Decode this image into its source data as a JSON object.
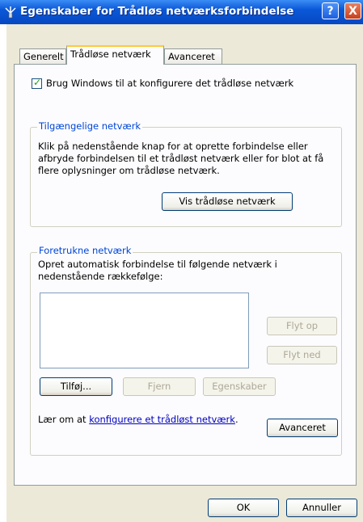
{
  "window": {
    "title": "Egenskaber for Trådløs netværksforbindelse",
    "help_label": "?",
    "close_label": "X"
  },
  "tabs": [
    {
      "label": "Generelt",
      "active": false
    },
    {
      "label": "Trådløse netværk",
      "active": true
    },
    {
      "label": "Avanceret",
      "active": false
    }
  ],
  "checkbox": {
    "label": "Brug Windows til at konfigurere det trådløse netværk",
    "checked": true
  },
  "available": {
    "title": "Tilgængelige netværk",
    "desc": [
      "Klik på nedenstående knap for at oprette forbindelse eller",
      "afbryde forbindelsen til et trådløst netværk eller for blot at få",
      "flere oplysninger om trådløse netværk."
    ],
    "button": "Vis trådløse netværk"
  },
  "preferred": {
    "title": "Foretrukne netværk",
    "desc": [
      "Opret automatisk forbindelse til følgende netværk i",
      "nedenstående rækkefølge:"
    ],
    "move_up": "Flyt op",
    "move_down": "Flyt ned",
    "add": "Tilføj...",
    "remove": "Fjern",
    "properties": "Egenskaber"
  },
  "learn": {
    "prefix": "Lær om at ",
    "link": "konfigurere et trådløst netværk",
    "suffix": "."
  },
  "advanced_button": "Avanceret",
  "footer": {
    "ok": "OK",
    "cancel": "Annuller"
  },
  "colors": {
    "titlebar": "#0a58d8",
    "dialog": "#ece9d8",
    "group_title": "#0046d5",
    "link": "#0000c0"
  }
}
